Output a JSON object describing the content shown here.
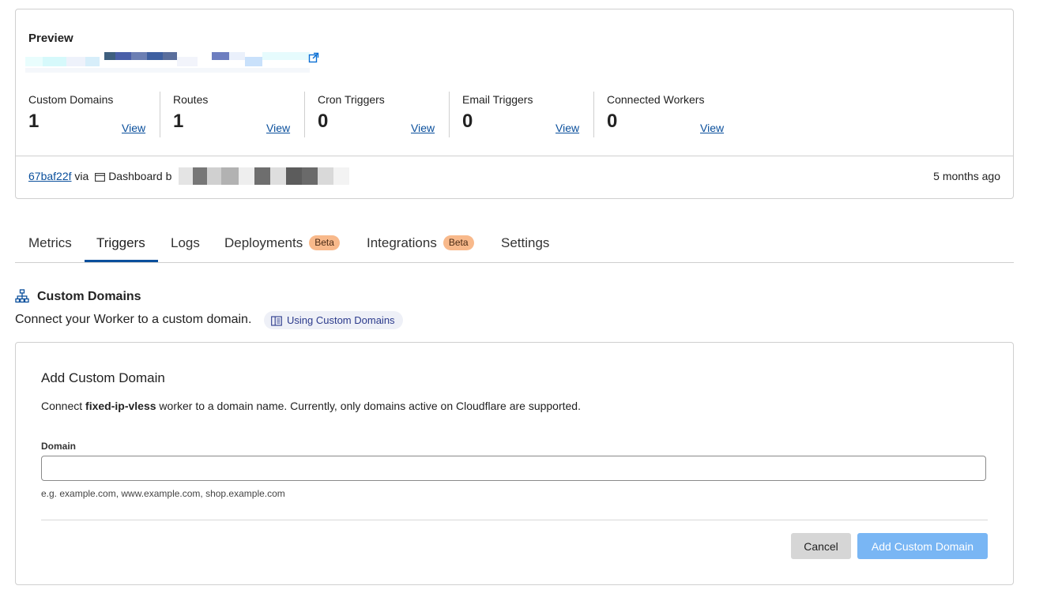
{
  "preview": {
    "title": "Preview",
    "url_hint": "·· 4040021 ··· ·· 571 ···· ···· ···"
  },
  "stats": [
    {
      "label": "Custom Domains",
      "value": "1",
      "view": "View"
    },
    {
      "label": "Routes",
      "value": "1",
      "view": "View"
    },
    {
      "label": "Cron Triggers",
      "value": "0",
      "view": "View"
    },
    {
      "label": "Email Triggers",
      "value": "0",
      "view": "View"
    },
    {
      "label": "Connected Workers",
      "value": "0",
      "view": "View"
    }
  ],
  "deployment": {
    "commit": "67baf22f",
    "via": "via",
    "source": "Dashboard b",
    "time_ago": "5 months ago"
  },
  "tabs": [
    {
      "label": "Metrics",
      "badge": ""
    },
    {
      "label": "Triggers",
      "badge": ""
    },
    {
      "label": "Logs",
      "badge": ""
    },
    {
      "label": "Deployments",
      "badge": "Beta"
    },
    {
      "label": "Integrations",
      "badge": "Beta"
    },
    {
      "label": "Settings",
      "badge": ""
    }
  ],
  "active_tab": "Triggers",
  "custom_domains": {
    "title": "Custom Domains",
    "description": "Connect your Worker to a custom domain.",
    "doc_link": "Using Custom Domains"
  },
  "form": {
    "title": "Add Custom Domain",
    "desc_prefix": "Connect ",
    "worker_name": "fixed-ip-vless",
    "desc_suffix": " worker to a domain name. Currently, only domains active on Cloudflare are supported.",
    "field_label": "Domain",
    "input_value": "",
    "hint": "e.g. example.com, www.example.com, shop.example.com",
    "cancel_label": "Cancel",
    "submit_label": "Add Custom Domain"
  },
  "colors": {
    "link": "#0a4f9c",
    "beta_badge": "#f8b98b",
    "primary_button_disabled": "#79b6f4",
    "cancel_button": "#d6d6d6"
  }
}
